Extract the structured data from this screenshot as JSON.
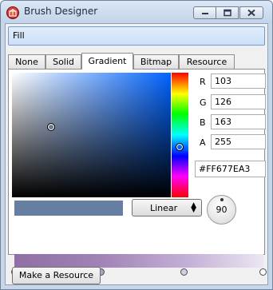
{
  "window": {
    "title": "Brush Designer",
    "app_icon": "app-logo-icon",
    "controls": [
      "minimize-icon",
      "maximize-icon",
      "close-icon"
    ]
  },
  "fill_field": {
    "label": "Fill"
  },
  "tabs": [
    {
      "label": "None",
      "active": false
    },
    {
      "label": "Solid",
      "active": false
    },
    {
      "label": "Gradient",
      "active": true
    },
    {
      "label": "Bitmap",
      "active": false
    },
    {
      "label": "Resource",
      "active": false
    }
  ],
  "color_picker": {
    "channels": [
      {
        "label": "R",
        "value": "103"
      },
      {
        "label": "G",
        "value": "126"
      },
      {
        "label": "B",
        "value": "163"
      },
      {
        "label": "A",
        "value": "255"
      }
    ],
    "hex": "#FF677EA3",
    "current_color": "#677EA3"
  },
  "gradient": {
    "type": "Linear",
    "angle": "90",
    "stops": [
      {
        "color": "#8f7fa6"
      },
      {
        "color": "#9f83b0"
      },
      {
        "color": "#b39fc4"
      },
      {
        "color": "#d8cce4"
      },
      {
        "color": "#ffffff"
      }
    ]
  },
  "actions": {
    "make_resource": "Make a Resource"
  }
}
